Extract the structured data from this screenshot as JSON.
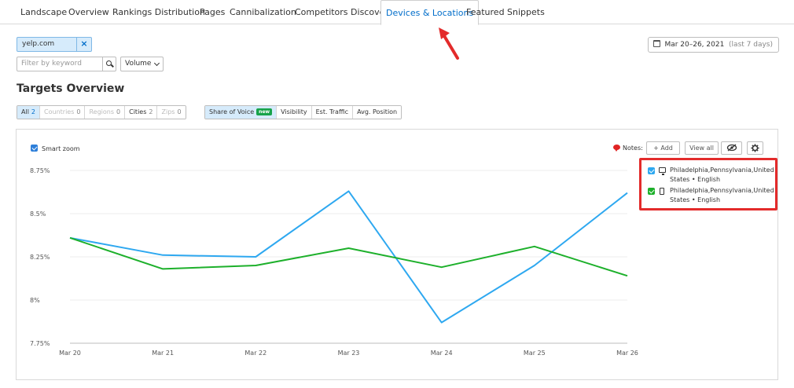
{
  "tabs": [
    {
      "label": "Landscape",
      "active": false
    },
    {
      "label": "Overview",
      "active": false
    },
    {
      "label": "Rankings Distribution",
      "active": false
    },
    {
      "label": "Pages",
      "active": false
    },
    {
      "label": "Cannibalization",
      "active": false
    },
    {
      "label": "Competitors Discovery",
      "active": false
    },
    {
      "label": "Devices & Locations",
      "active": true
    },
    {
      "label": "Featured Snippets",
      "active": false
    }
  ],
  "domain": {
    "value": "yelp.com",
    "remove_label": "×"
  },
  "date_range": {
    "label": "Mar 20–26, 2021",
    "note": "(last 7 days)"
  },
  "filter": {
    "placeholder": "Filter by keyword",
    "volume_label": "Volume"
  },
  "section_title": "Targets Overview",
  "target_filters": [
    {
      "label": "All",
      "count": "2",
      "state": "on"
    },
    {
      "label": "Countries",
      "count": "0",
      "state": "off"
    },
    {
      "label": "Regions",
      "count": "0",
      "state": "off"
    },
    {
      "label": "Cities",
      "count": "2",
      "state": "normal"
    },
    {
      "label": "Zips",
      "count": "0",
      "state": "off"
    }
  ],
  "metric_tabs": [
    {
      "label": "Share of Voice",
      "badge": "new",
      "state": "on"
    },
    {
      "label": "Visibility",
      "state": "normal"
    },
    {
      "label": "Est. Traffic",
      "state": "normal"
    },
    {
      "label": "Avg. Position",
      "state": "normal"
    }
  ],
  "chart_controls": {
    "smart_zoom_label": "Smart zoom",
    "notes_label": "Notes:",
    "add_label": "+ Add",
    "view_all_label": "View all"
  },
  "legend": [
    {
      "device": "monitor-icon",
      "label": "Philadelphia,Pennsylvania,United States • English",
      "color": "#2ea8f0"
    },
    {
      "device": "phone-icon",
      "label": "Philadelphia,Pennsylvania,United States • English",
      "color": "#1db02b"
    }
  ],
  "colors": {
    "accent": "#006dca",
    "desktop": "#2ea8f0",
    "mobile": "#1db02b",
    "highlight": "#e32b2b"
  },
  "chart_data": {
    "type": "line",
    "categories": [
      "Mar 20",
      "Mar 21",
      "Mar 22",
      "Mar 23",
      "Mar 24",
      "Mar 25",
      "Mar 26"
    ],
    "y_ticks": [
      "7.75%",
      "8%",
      "8.25%",
      "8.5%",
      "8.75%"
    ],
    "ylim": [
      7.75,
      8.75
    ],
    "grid": true,
    "legend_position": "top-right",
    "series": [
      {
        "name": "Philadelphia,Pennsylvania,United States • English",
        "device": "desktop",
        "color": "#2ea8f0",
        "values": [
          8.36,
          8.26,
          8.25,
          8.63,
          7.87,
          8.2,
          8.62
        ]
      },
      {
        "name": "Philadelphia,Pennsylvania,United States • English",
        "device": "mobile",
        "color": "#1db02b",
        "values": [
          8.36,
          8.18,
          8.2,
          8.3,
          8.19,
          8.31,
          8.14
        ]
      }
    ]
  }
}
